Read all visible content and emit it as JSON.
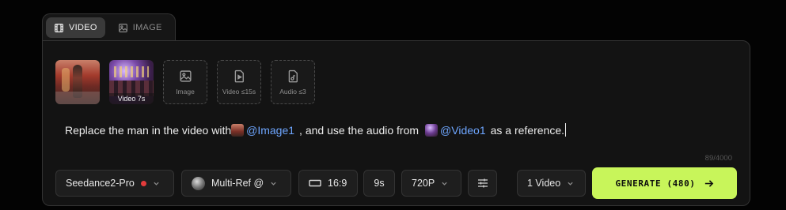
{
  "tabs": [
    {
      "label": "VIDEO",
      "icon": "film-icon",
      "active": true
    },
    {
      "label": "IMAGE",
      "icon": "image-icon",
      "active": false
    }
  ],
  "media": {
    "thumb2_caption": "Video 7s",
    "slots": [
      {
        "label": "Image",
        "icon": "image-icon"
      },
      {
        "label": "Video ≤15s",
        "icon": "video-file-icon"
      },
      {
        "label": "Audio ≤3",
        "icon": "audio-file-icon"
      }
    ]
  },
  "prompt": {
    "part1": "Replace the man in the video with",
    "mention1": "@Image1",
    "part2": ", and use the audio from",
    "mention2": "@Video1",
    "part3": "as a reference.",
    "mention_color": "#6ea6ff"
  },
  "counter": "89/4000",
  "controls": {
    "model": "Seedance2-Pro",
    "model_status_color": "#e33b3b",
    "reference_mode": "Multi-Ref @",
    "aspect_ratio": "16:9",
    "duration": "9s",
    "resolution": "720P",
    "settings_icon": "sliders-icon",
    "count": "1 Video"
  },
  "generate": {
    "label": "GENERATE (480)",
    "accent": "#c8f55a"
  }
}
